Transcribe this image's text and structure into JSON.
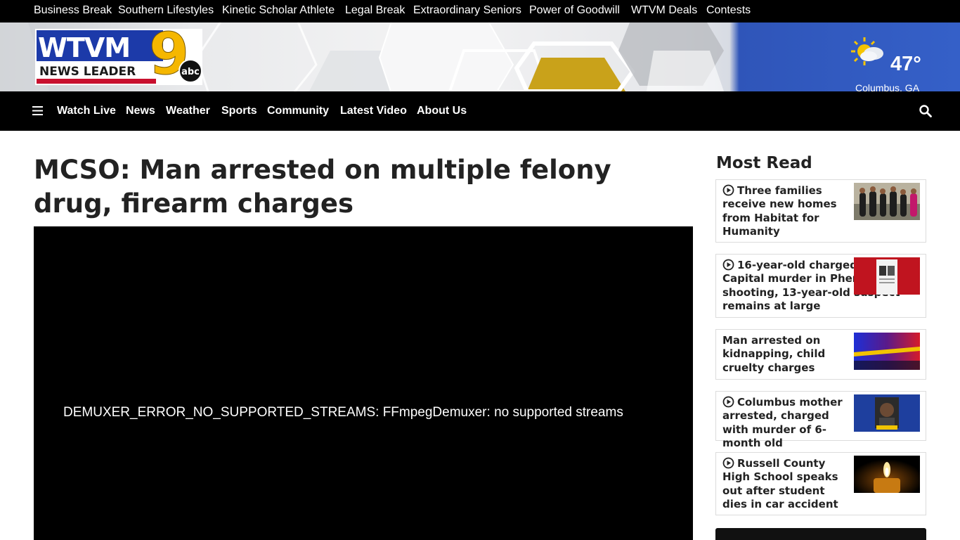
{
  "topbar": {
    "links": [
      "Business Break",
      "Southern Lifestyles",
      "Kinetic Scholar Athlete",
      "Legal Break",
      "Extraordinary Seniors",
      "Power of Goodwill",
      "WTVM Deals",
      "Contests"
    ]
  },
  "logo": {
    "call_letters": "WTVM",
    "tagline": "NEWS LEADER",
    "channel": "9",
    "network": "abc"
  },
  "weather": {
    "temperature": "47°",
    "location": "Columbus, GA",
    "icon": "partly-cloudy-icon"
  },
  "mainnav": {
    "items": [
      "Watch Live",
      "News",
      "Weather",
      "Sports",
      "Community",
      "Latest Video",
      "About Us"
    ]
  },
  "article": {
    "headline": "MCSO: Man arrested on multiple felony drug, firearm charges"
  },
  "video": {
    "error_message": "DEMUXER_ERROR_NO_SUPPORTED_STREAMS: FFmpegDemuxer: no supported streams"
  },
  "sidebar": {
    "title": "Most Read",
    "items": [
      {
        "title": "Three families receive new homes from Habitat for Humanity",
        "has_video": true
      },
      {
        "title": "16-year-old charged with Capital murder in Phenix City shooting, 13-year-old suspect remains at large",
        "has_video": true
      },
      {
        "title": "Man arrested on kidnapping, child cruelty charges",
        "has_video": false
      },
      {
        "title": "Columbus mother arrested, charged with murder of 6-month old",
        "has_video": true
      },
      {
        "title": "Russell County High School speaks out after student dies in car accident",
        "has_video": true
      }
    ]
  },
  "colors": {
    "bar_background": "#000000",
    "banner_blue": "#3560c8",
    "logo_blue": "#1c3aa9",
    "logo_red": "#c8102e",
    "logo_gold": "#f5b700"
  }
}
